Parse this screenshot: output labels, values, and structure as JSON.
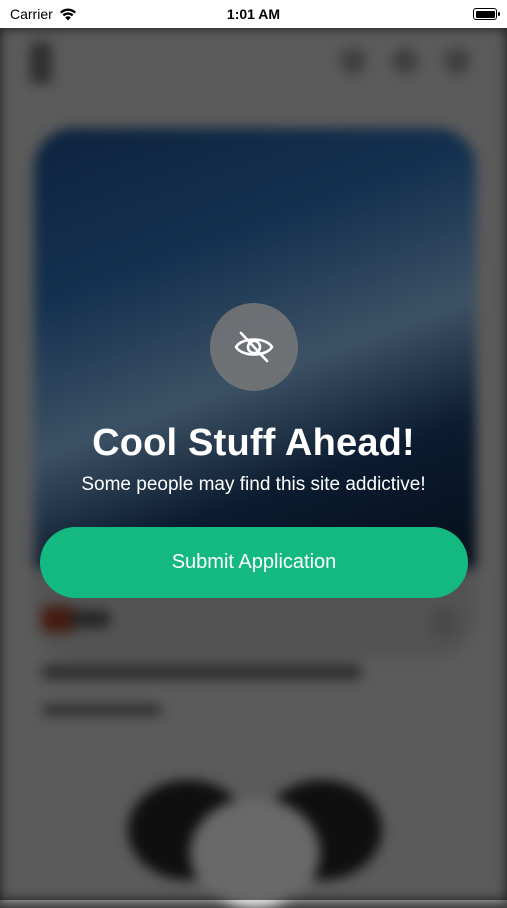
{
  "status_bar": {
    "carrier": "Carrier",
    "time": "1:01 AM",
    "wifi_icon": "wifi-icon",
    "battery_icon": "battery-icon"
  },
  "modal": {
    "icon": "eye-off-icon",
    "title": "Cool Stuff Ahead!",
    "subtitle": "Some people may find this site addictive!",
    "button_label": "Submit Application"
  },
  "colors": {
    "accent": "#13B981",
    "overlay": "#000000"
  }
}
